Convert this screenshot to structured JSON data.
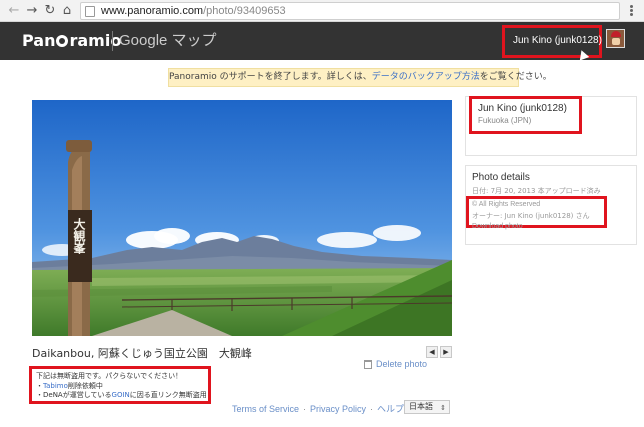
{
  "browser": {
    "url_host": "www.panoramio.com",
    "url_path": "/photo/93409653",
    "back_icon": "arrow-left-icon",
    "forward_icon": "arrow-right-icon",
    "reload_icon": "reload-icon"
  },
  "header": {
    "logo_left": "Pan",
    "logo_right": "ramio",
    "service_label": "Google マップ",
    "user_name": "Jun Kino (junk0128)"
  },
  "notice": {
    "text_before": "Panoramio のサポートを終了します。詳しくは、",
    "link_text": "データのバックアップ方法",
    "text_after": "をご覧ください。"
  },
  "photo": {
    "sign_text": "大観峯",
    "title": "Daikanbou, 阿蘇くじゅう国立公園　大観峰",
    "delete_label": "Delete photo"
  },
  "warning": {
    "line1": "下記は無断盗用です。パクらないでください！",
    "line2_prefix": "・",
    "line2_link": "Tabimo",
    "line2_suffix": "削除依頼中",
    "line3_prefix": "・DeNAが運営している",
    "line3_link": "GOIN",
    "line3_suffix": "に因る直リンク無断盗用"
  },
  "footer": {
    "terms": "Terms of Service",
    "privacy": "Privacy Policy",
    "help": "ヘルプ",
    "language": "日本語"
  },
  "sidebar": {
    "owner_name": "Jun Kino (junk0128)",
    "owner_location": "Fukuoka (JPN)",
    "details_title": "Photo details",
    "details_date": "日付: 7月 20, 2013 本アップロード済み",
    "details_rights": "© All Rights Reserved",
    "details_owner": "オーナー: Jun Kino (junk0128) さん",
    "details_download": "Download photo"
  },
  "colors": {
    "header_bg": "#333333",
    "highlight_red": "#e0141e",
    "link_blue": "#3a6fc8",
    "notice_bg": "#fef0c4"
  }
}
